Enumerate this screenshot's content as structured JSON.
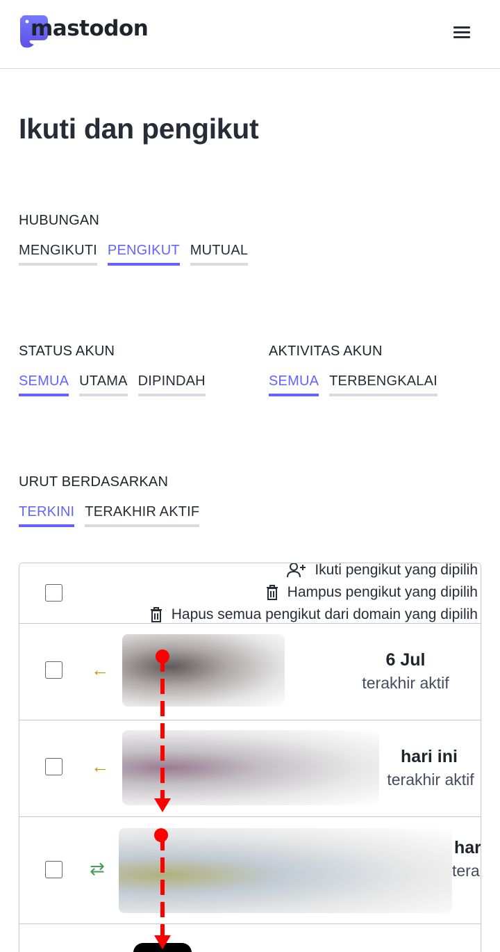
{
  "header": {
    "logo_text": "mastodon",
    "menu_icon": "hamburger-menu-icon",
    "brand_color": "#6364ff"
  },
  "page": {
    "title": "Ikuti dan pengikut"
  },
  "filters": {
    "relationship": {
      "label": "HUBUNGAN",
      "options": [
        "MENGIKUTI",
        "PENGIKUT",
        "MUTUAL"
      ],
      "selected": "PENGIKUT"
    },
    "account_status": {
      "label": "STATUS AKUN",
      "options": [
        "SEMUA",
        "UTAMA",
        "DIPINDAH"
      ],
      "selected": "SEMUA"
    },
    "account_activity": {
      "label": "AKTIVITAS AKUN",
      "options": [
        "SEMUA",
        "TERBENGKALAI"
      ],
      "selected": "SEMUA"
    },
    "sort": {
      "label": "URUT BERDASARKAN",
      "options": [
        "TERKINI",
        "TERAKHIR AKTIF"
      ],
      "selected": "TERKINI"
    }
  },
  "table": {
    "actions": [
      {
        "label": "Ikuti pengikut yang dipilih",
        "icon": "user-plus-icon"
      },
      {
        "label": "Hampus pengikut yang dipilih",
        "icon": "trash-icon"
      },
      {
        "label": "Hapus semua pengikut dari domain yang dipilih",
        "icon": "trash-icon"
      }
    ],
    "rows": [
      {
        "relationship_icon": "follower-arrow-icon",
        "glyph": "←",
        "last_active": "6 Jul",
        "last_active_label": "terakhir aktif"
      },
      {
        "relationship_icon": "follower-arrow-icon",
        "glyph": "←",
        "last_active": "hari ini",
        "last_active_label": "terakhir aktif"
      },
      {
        "relationship_icon": "mutual-arrows-icon",
        "glyph": "⇄",
        "last_active": "hari ini",
        "last_active_label": "terakhir aktif"
      }
    ],
    "colors": {
      "follower_icon": "#c7920c",
      "mutual_icon": "#4f9a5e",
      "annotation_red": "#ff0000"
    }
  }
}
